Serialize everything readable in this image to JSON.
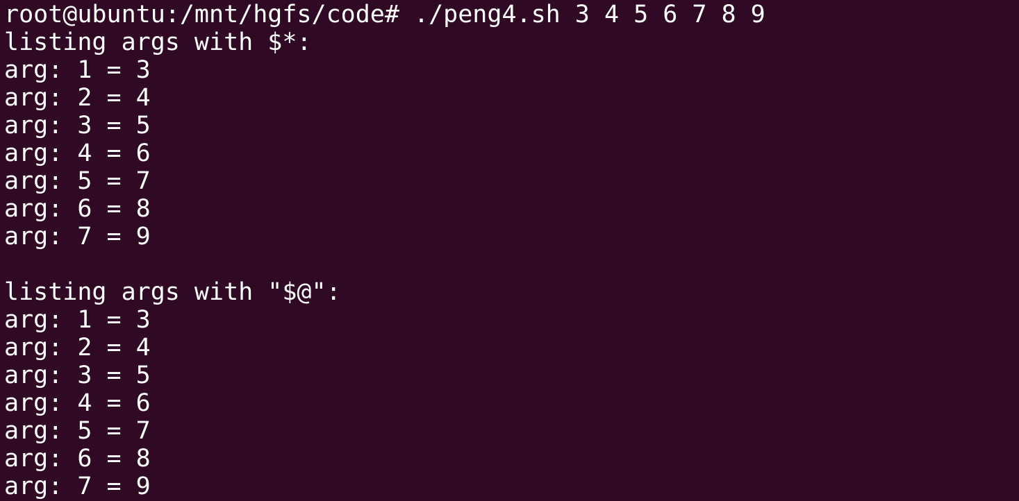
{
  "terminal": {
    "background": "#300a24",
    "foreground": "#ffffff",
    "prompt_line": "root@ubuntu:/mnt/hgfs/code# ./peng4.sh 3 4 5 6 7 8 9",
    "lines": [
      "listing args with $*:",
      "arg: 1 = 3",
      "arg: 2 = 4",
      "arg: 3 = 5",
      "arg: 4 = 6",
      "arg: 5 = 7",
      "arg: 6 = 8",
      "arg: 7 = 9",
      "",
      "listing args with \"$@\":",
      "arg: 1 = 3",
      "arg: 2 = 4",
      "arg: 3 = 5",
      "arg: 4 = 6",
      "arg: 5 = 7",
      "arg: 6 = 8",
      "arg: 7 = 9"
    ]
  }
}
